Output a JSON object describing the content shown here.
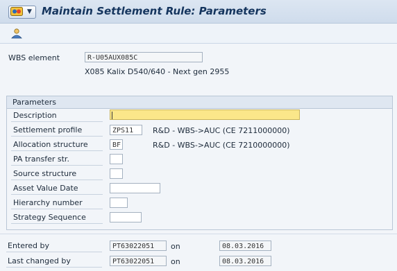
{
  "title": "Maintain Settlement Rule: Parameters",
  "colors": {
    "title_bar": "#d6e2f0",
    "required_field": "#fbe78a",
    "title_text": "#15355e"
  },
  "icons": {
    "app_menu": "sap-logo-icon",
    "menu_dropdown": "chevron-down-icon",
    "toolbar_tool": "person-icon"
  },
  "wbs": {
    "label": "WBS element",
    "value": "R-U05AUX085C",
    "description": "X085 Kalix D540/640 - Next gen 2955"
  },
  "params": {
    "group_title": "Parameters",
    "description": {
      "label": "Description",
      "value": ""
    },
    "settlement_profile": {
      "label": "Settlement profile",
      "value": "ZPS11",
      "text": "R&D - WBS->AUC (CE 7211000000)"
    },
    "allocation_structure": {
      "label": "Allocation structure",
      "value": "BF",
      "text": "R&D - WBS->AUC (CE 7210000000)"
    },
    "pa_transfer": {
      "label": "PA transfer str.",
      "value": ""
    },
    "source_structure": {
      "label": "Source structure",
      "value": ""
    },
    "asset_value_date": {
      "label": "Asset Value Date",
      "value": ""
    },
    "hierarchy_number": {
      "label": "Hierarchy number",
      "value": ""
    },
    "strategy_sequence": {
      "label": "Strategy Sequence",
      "value": ""
    }
  },
  "footer": {
    "entered_by": {
      "label": "Entered by",
      "user": "PT63022051",
      "on": "on",
      "date": "08.03.2016"
    },
    "last_changed_by": {
      "label": "Last changed by",
      "user": "PT63022051",
      "on": "on",
      "date": "08.03.2016"
    }
  }
}
